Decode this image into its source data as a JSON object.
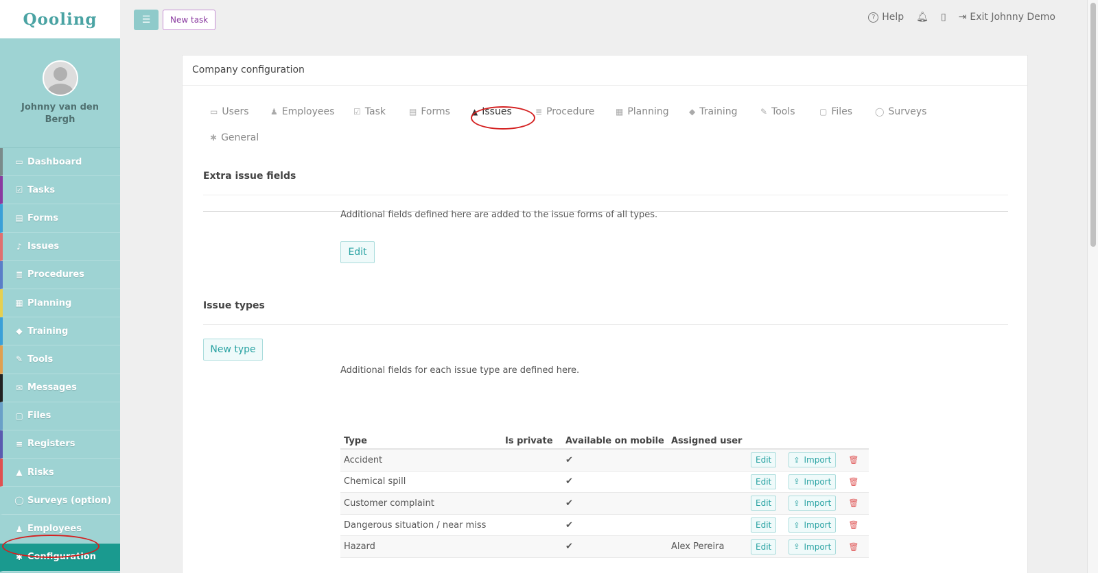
{
  "brand": "Qooling",
  "user": {
    "name": "Johnny van den Bergh"
  },
  "sidebar": {
    "items": [
      {
        "label": "Dashboard",
        "icon": "monitor-icon",
        "glyph": "▭",
        "color": "#7a8a8a"
      },
      {
        "label": "Tasks",
        "icon": "checkbox-icon",
        "glyph": "☑",
        "color": "#8a3aa0"
      },
      {
        "label": "Forms",
        "icon": "document-icon",
        "glyph": "▤",
        "color": "#3aa0d8"
      },
      {
        "label": "Issues",
        "icon": "bell-icon",
        "glyph": "♪",
        "color": "#e07070"
      },
      {
        "label": "Procedures",
        "icon": "list-icon",
        "glyph": "≣",
        "color": "#5a7ec8"
      },
      {
        "label": "Planning",
        "icon": "calendar-icon",
        "glyph": "▦",
        "color": "#e6d050"
      },
      {
        "label": "Training",
        "icon": "graduation-cap-icon",
        "glyph": "◆",
        "color": "#3aa0d8"
      },
      {
        "label": "Tools",
        "icon": "wrench-icon",
        "glyph": "✎",
        "color": "#e0a050"
      },
      {
        "label": "Messages",
        "icon": "envelope-icon",
        "glyph": "✉",
        "color": "#222222"
      },
      {
        "label": "Files",
        "icon": "file-icon",
        "glyph": "▢",
        "color": "#6aa0c8"
      },
      {
        "label": "Registers",
        "icon": "list-icon",
        "glyph": "≡",
        "color": "#5a5ab0"
      },
      {
        "label": "Risks",
        "icon": "warning-icon",
        "glyph": "▲",
        "color": "#e05050"
      },
      {
        "label": "Surveys (option)",
        "icon": "comment-icon",
        "glyph": "◯",
        "color": "#9ed3d3"
      },
      {
        "label": "Employees",
        "icon": "users-icon",
        "glyph": "♟",
        "color": "#9ed3d3"
      },
      {
        "label": "Configuration",
        "icon": "gear-icon",
        "glyph": "✱",
        "color": "#1a9a8f"
      }
    ],
    "active": "Configuration"
  },
  "topbar": {
    "new_task": "New task",
    "help": "Help",
    "exit": "Exit Johnny Demo"
  },
  "page": {
    "title": "Company configuration",
    "tabs": [
      {
        "label": "Users",
        "icon": "id-card-icon",
        "glyph": "▭"
      },
      {
        "label": "Employees",
        "icon": "users-icon",
        "glyph": "♟"
      },
      {
        "label": "Task",
        "icon": "checkbox-icon",
        "glyph": "☑"
      },
      {
        "label": "Forms",
        "icon": "document-icon",
        "glyph": "▤"
      },
      {
        "label": "Issues",
        "icon": "bell-icon",
        "glyph": "▲"
      },
      {
        "label": "Procedure",
        "icon": "list-icon",
        "glyph": "≣"
      },
      {
        "label": "Planning",
        "icon": "calendar-icon",
        "glyph": "▦"
      },
      {
        "label": "Training",
        "icon": "graduation-cap-icon",
        "glyph": "◆"
      },
      {
        "label": "Tools",
        "icon": "wrench-icon",
        "glyph": "✎"
      },
      {
        "label": "Files",
        "icon": "file-icon",
        "glyph": "▢"
      },
      {
        "label": "Surveys",
        "icon": "comment-icon",
        "glyph": "◯"
      },
      {
        "label": "General",
        "icon": "gear-icon",
        "glyph": "✱"
      }
    ],
    "active_tab": "Issues",
    "extra_fields": {
      "title": "Extra issue fields",
      "desc": "Additional fields defined here are added to the issue forms of all types.",
      "edit": "Edit"
    },
    "issue_types": {
      "title": "Issue types",
      "new_type": "New type",
      "desc": "Additional fields for each issue type are defined here.",
      "columns": [
        "Type",
        "Is private",
        "Available on mobile",
        "Assigned user"
      ],
      "edit_label": "Edit",
      "import_label": "Import",
      "rows": [
        {
          "type": "Accident",
          "private": "",
          "mobile": "✔",
          "user": ""
        },
        {
          "type": "Chemical spill",
          "private": "",
          "mobile": "✔",
          "user": ""
        },
        {
          "type": "Customer complaint",
          "private": "",
          "mobile": "✔",
          "user": ""
        },
        {
          "type": "Dangerous situation / near miss",
          "private": "",
          "mobile": "✔",
          "user": ""
        },
        {
          "type": "Hazard",
          "private": "",
          "mobile": "✔",
          "user": "Alex Pereira"
        }
      ]
    }
  }
}
